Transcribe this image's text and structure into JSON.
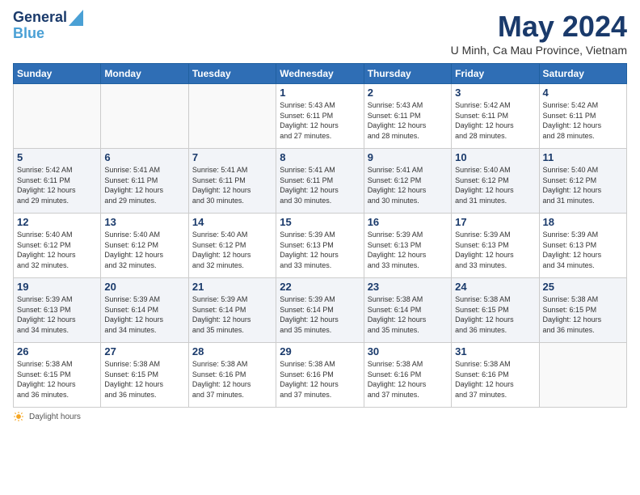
{
  "header": {
    "logo_line1": "General",
    "logo_line2": "Blue",
    "month": "May 2024",
    "location": "U Minh, Ca Mau Province, Vietnam"
  },
  "days_of_week": [
    "Sunday",
    "Monday",
    "Tuesday",
    "Wednesday",
    "Thursday",
    "Friday",
    "Saturday"
  ],
  "weeks": [
    [
      {
        "num": "",
        "info": ""
      },
      {
        "num": "",
        "info": ""
      },
      {
        "num": "",
        "info": ""
      },
      {
        "num": "1",
        "info": "Sunrise: 5:43 AM\nSunset: 6:11 PM\nDaylight: 12 hours\nand 27 minutes."
      },
      {
        "num": "2",
        "info": "Sunrise: 5:43 AM\nSunset: 6:11 PM\nDaylight: 12 hours\nand 28 minutes."
      },
      {
        "num": "3",
        "info": "Sunrise: 5:42 AM\nSunset: 6:11 PM\nDaylight: 12 hours\nand 28 minutes."
      },
      {
        "num": "4",
        "info": "Sunrise: 5:42 AM\nSunset: 6:11 PM\nDaylight: 12 hours\nand 28 minutes."
      }
    ],
    [
      {
        "num": "5",
        "info": "Sunrise: 5:42 AM\nSunset: 6:11 PM\nDaylight: 12 hours\nand 29 minutes."
      },
      {
        "num": "6",
        "info": "Sunrise: 5:41 AM\nSunset: 6:11 PM\nDaylight: 12 hours\nand 29 minutes."
      },
      {
        "num": "7",
        "info": "Sunrise: 5:41 AM\nSunset: 6:11 PM\nDaylight: 12 hours\nand 30 minutes."
      },
      {
        "num": "8",
        "info": "Sunrise: 5:41 AM\nSunset: 6:11 PM\nDaylight: 12 hours\nand 30 minutes."
      },
      {
        "num": "9",
        "info": "Sunrise: 5:41 AM\nSunset: 6:12 PM\nDaylight: 12 hours\nand 30 minutes."
      },
      {
        "num": "10",
        "info": "Sunrise: 5:40 AM\nSunset: 6:12 PM\nDaylight: 12 hours\nand 31 minutes."
      },
      {
        "num": "11",
        "info": "Sunrise: 5:40 AM\nSunset: 6:12 PM\nDaylight: 12 hours\nand 31 minutes."
      }
    ],
    [
      {
        "num": "12",
        "info": "Sunrise: 5:40 AM\nSunset: 6:12 PM\nDaylight: 12 hours\nand 32 minutes."
      },
      {
        "num": "13",
        "info": "Sunrise: 5:40 AM\nSunset: 6:12 PM\nDaylight: 12 hours\nand 32 minutes."
      },
      {
        "num": "14",
        "info": "Sunrise: 5:40 AM\nSunset: 6:12 PM\nDaylight: 12 hours\nand 32 minutes."
      },
      {
        "num": "15",
        "info": "Sunrise: 5:39 AM\nSunset: 6:13 PM\nDaylight: 12 hours\nand 33 minutes."
      },
      {
        "num": "16",
        "info": "Sunrise: 5:39 AM\nSunset: 6:13 PM\nDaylight: 12 hours\nand 33 minutes."
      },
      {
        "num": "17",
        "info": "Sunrise: 5:39 AM\nSunset: 6:13 PM\nDaylight: 12 hours\nand 33 minutes."
      },
      {
        "num": "18",
        "info": "Sunrise: 5:39 AM\nSunset: 6:13 PM\nDaylight: 12 hours\nand 34 minutes."
      }
    ],
    [
      {
        "num": "19",
        "info": "Sunrise: 5:39 AM\nSunset: 6:13 PM\nDaylight: 12 hours\nand 34 minutes."
      },
      {
        "num": "20",
        "info": "Sunrise: 5:39 AM\nSunset: 6:14 PM\nDaylight: 12 hours\nand 34 minutes."
      },
      {
        "num": "21",
        "info": "Sunrise: 5:39 AM\nSunset: 6:14 PM\nDaylight: 12 hours\nand 35 minutes."
      },
      {
        "num": "22",
        "info": "Sunrise: 5:39 AM\nSunset: 6:14 PM\nDaylight: 12 hours\nand 35 minutes."
      },
      {
        "num": "23",
        "info": "Sunrise: 5:38 AM\nSunset: 6:14 PM\nDaylight: 12 hours\nand 35 minutes."
      },
      {
        "num": "24",
        "info": "Sunrise: 5:38 AM\nSunset: 6:15 PM\nDaylight: 12 hours\nand 36 minutes."
      },
      {
        "num": "25",
        "info": "Sunrise: 5:38 AM\nSunset: 6:15 PM\nDaylight: 12 hours\nand 36 minutes."
      }
    ],
    [
      {
        "num": "26",
        "info": "Sunrise: 5:38 AM\nSunset: 6:15 PM\nDaylight: 12 hours\nand 36 minutes."
      },
      {
        "num": "27",
        "info": "Sunrise: 5:38 AM\nSunset: 6:15 PM\nDaylight: 12 hours\nand 36 minutes."
      },
      {
        "num": "28",
        "info": "Sunrise: 5:38 AM\nSunset: 6:16 PM\nDaylight: 12 hours\nand 37 minutes."
      },
      {
        "num": "29",
        "info": "Sunrise: 5:38 AM\nSunset: 6:16 PM\nDaylight: 12 hours\nand 37 minutes."
      },
      {
        "num": "30",
        "info": "Sunrise: 5:38 AM\nSunset: 6:16 PM\nDaylight: 12 hours\nand 37 minutes."
      },
      {
        "num": "31",
        "info": "Sunrise: 5:38 AM\nSunset: 6:16 PM\nDaylight: 12 hours\nand 37 minutes."
      },
      {
        "num": "",
        "info": ""
      }
    ]
  ],
  "footer": {
    "daylight_label": "Daylight hours"
  }
}
